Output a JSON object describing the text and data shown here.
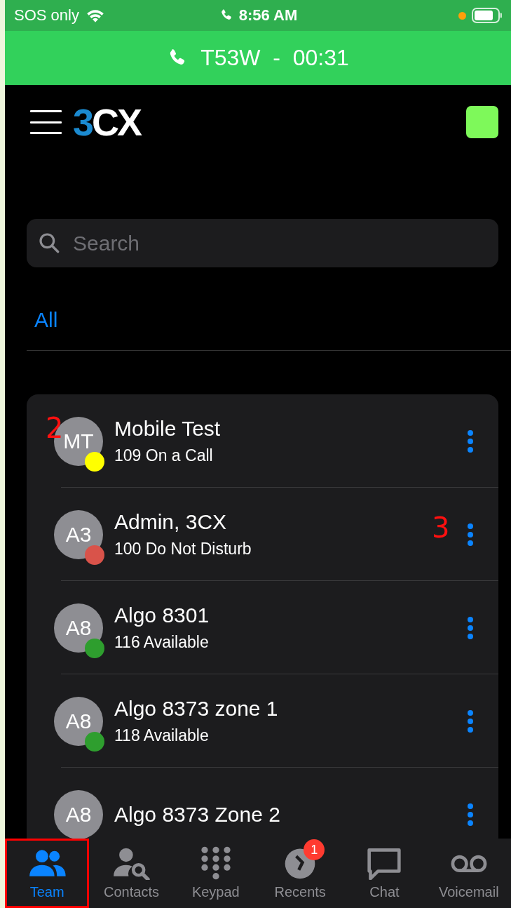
{
  "status_bar": {
    "carrier": "SOS only",
    "time": "8:56 AM"
  },
  "call_banner": {
    "text": "T53W  -  00:31"
  },
  "header": {
    "logo": {
      "accent": "3",
      "rest": "CX"
    }
  },
  "search": {
    "placeholder": "Search"
  },
  "filters": [
    {
      "label": "All",
      "selected": true
    }
  ],
  "contacts": [
    {
      "initials": "MT",
      "name": "Mobile Test",
      "status": "109 On a Call",
      "color": "#ffff00",
      "annotation": {
        "text": "2",
        "kind": "avatar"
      }
    },
    {
      "initials": "A3",
      "name": "Admin, 3CX",
      "status": "100 Do Not Disturb",
      "color": "#d9534a",
      "annotation": {
        "text": "3",
        "kind": "menu"
      }
    },
    {
      "initials": "A8",
      "name": "Algo 8301",
      "status": "116 Available",
      "color": "#2e9e2e"
    },
    {
      "initials": "A8",
      "name": "Algo 8373 zone 1",
      "status": "118 Available",
      "color": "#2e9e2e"
    },
    {
      "initials": "A8",
      "name": "Algo 8373 Zone 2"
    }
  ],
  "tabs": [
    {
      "kind": "team",
      "label": "Team",
      "selected": true,
      "outlined": true
    },
    {
      "kind": "contacts",
      "label": "Contacts",
      "selected": false
    },
    {
      "kind": "keypad",
      "label": "Keypad",
      "selected": false
    },
    {
      "kind": "recents",
      "label": "Recents",
      "selected": false,
      "badge": "1"
    },
    {
      "kind": "chat",
      "label": "Chat",
      "selected": false
    },
    {
      "kind": "voicemail",
      "label": "Voicemail",
      "selected": false
    }
  ]
}
